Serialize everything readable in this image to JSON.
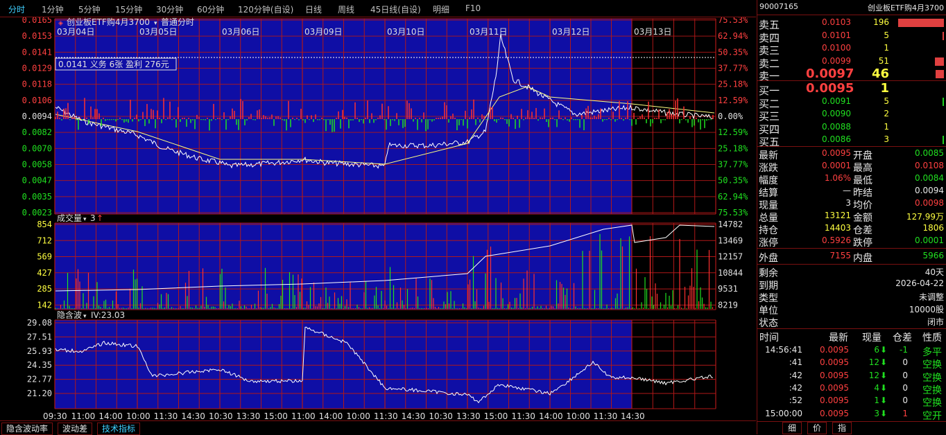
{
  "toolbar": {
    "items": [
      "分时",
      "1分钟",
      "5分钟",
      "15分钟",
      "30分钟",
      "60分钟",
      "120分钟(自设)",
      "日线",
      "周线",
      "45日线(自设)",
      "明细",
      "F10"
    ],
    "active_index": 0
  },
  "chart": {
    "instrument_label": "创业板ETF购4月3700",
    "mode_label": "普通分时",
    "days": [
      "03月04日",
      "03月05日",
      "03月06日",
      "03月09日",
      "03月10日",
      "03月11日",
      "03月12日",
      "03月13日"
    ],
    "price_axis": [
      "0.0165",
      "0.0153",
      "0.0141",
      "0.0129",
      "0.0118",
      "0.0106",
      "0.0094",
      "0.0082",
      "0.0070",
      "0.0058",
      "0.0047",
      "0.0035",
      "0.0023"
    ],
    "pct_axis": [
      "75.53%",
      "62.94%",
      "50.35%",
      "37.77%",
      "25.18%",
      "12.59%",
      "0.00%",
      "12.59%",
      "25.18%",
      "37.77%",
      "50.35%",
      "62.94%",
      "75.53%"
    ],
    "tooltip": "0.0141 义务  6张  盈利  276元",
    "volume_label": "成交量",
    "volume_value": "3",
    "volume_axis_left": [
      "854",
      "712",
      "569",
      "427",
      "285",
      "142"
    ],
    "volume_axis_right": [
      "14782",
      "13469",
      "12157",
      "10844",
      "9531",
      "8219"
    ],
    "iv_label": "隐含波",
    "iv_value": "IV:23.03",
    "iv_axis": [
      "29.08",
      "27.51",
      "25.93",
      "24.35",
      "22.77",
      "21.20"
    ],
    "time_axis": [
      "09:30",
      "11:00",
      "14:00",
      "10:00",
      "11:30",
      "14:30",
      "10:30",
      "13:30",
      "15:00",
      "11:00",
      "14:00",
      "10:00",
      "11:30",
      "14:30",
      "10:30",
      "13:30",
      "15:00",
      "11:30",
      "14:00",
      "10:00",
      "11:30",
      "14:30"
    ]
  },
  "bottom_tabs": [
    "隐含波动率",
    "波动差",
    "技术指标"
  ],
  "bottom_active": 2,
  "quote": {
    "code": "90007165",
    "name": "创业板ETF购4月3700",
    "asks": [
      {
        "label": "卖五",
        "price": "0.0103",
        "vol": "196",
        "bar": 1.0
      },
      {
        "label": "卖四",
        "price": "0.0101",
        "vol": "5",
        "bar": 0.02
      },
      {
        "label": "卖三",
        "price": "0.0100",
        "vol": "1",
        "bar": 0.0
      },
      {
        "label": "卖二",
        "price": "0.0099",
        "vol": "51",
        "bar": 0.2
      },
      {
        "label": "卖一",
        "price": "0.0097",
        "vol": "46",
        "bar": 0.18
      }
    ],
    "bids": [
      {
        "label": "买一",
        "price": "0.0095",
        "vol": "1",
        "bar": 0.0
      },
      {
        "label": "买二",
        "price": "0.0091",
        "vol": "5",
        "bar": 0.02
      },
      {
        "label": "买三",
        "price": "0.0090",
        "vol": "2",
        "bar": 0.0
      },
      {
        "label": "买四",
        "price": "0.0088",
        "vol": "1",
        "bar": 0.0
      },
      {
        "label": "买五",
        "price": "0.0086",
        "vol": "3",
        "bar": 0.01
      }
    ],
    "stats": [
      {
        "l1": "最新",
        "v1": "0.0095",
        "c1": "red",
        "l2": "开盘",
        "v2": "0.0085",
        "c2": "green"
      },
      {
        "l1": "涨跌",
        "v1": "0.0001",
        "c1": "red",
        "l2": "最高",
        "v2": "0.0108",
        "c2": "red"
      },
      {
        "l1": "幅度",
        "v1": "1.06%",
        "c1": "red",
        "l2": "最低",
        "v2": "0.0084",
        "c2": "green"
      },
      {
        "l1": "结算",
        "v1": "—",
        "c1": "white",
        "l2": "昨结",
        "v2": "0.0094",
        "c2": "white"
      },
      {
        "l1": "现量",
        "v1": "3",
        "c1": "white",
        "l2": "均价",
        "v2": "0.0098",
        "c2": "red"
      },
      {
        "l1": "总量",
        "v1": "13121",
        "c1": "yellow",
        "l2": "金额",
        "v2": "127.99万",
        "c2": "yellow"
      },
      {
        "l1": "持仓",
        "v1": "14403",
        "c1": "yellow",
        "l2": "仓差",
        "v2": "1806",
        "c2": "yellow"
      },
      {
        "l1": "涨停",
        "v1": "0.5926",
        "c1": "red",
        "l2": "跌停",
        "v2": "0.0001",
        "c2": "green"
      }
    ],
    "outer": {
      "label": "外盘",
      "value": "7155",
      "inner_label": "内盘",
      "inner_value": "5966"
    },
    "info": [
      {
        "label": "剩余",
        "value": "40天"
      },
      {
        "label": "到期",
        "value": "2026-04-22"
      },
      {
        "label": "类型",
        "value": "未调整"
      },
      {
        "label": "单位",
        "value": "10000股"
      },
      {
        "label": "状态",
        "value": "闭市"
      }
    ],
    "ticks_header": {
      "time": "时间",
      "last": "最新",
      "qty": "现量",
      "oi": "仓差",
      "nature": "性质"
    },
    "ticks": [
      {
        "time": "14:56:41",
        "price": "0.0095",
        "qty": "6",
        "oi": "-1",
        "nature": "多平"
      },
      {
        "time": ":41",
        "price": "0.0095",
        "qty": "12",
        "oi": "0",
        "nature": "空换"
      },
      {
        "time": ":42",
        "price": "0.0095",
        "qty": "12",
        "oi": "0",
        "nature": "空换"
      },
      {
        "time": ":42",
        "price": "0.0095",
        "qty": "4",
        "oi": "0",
        "nature": "空换"
      },
      {
        "time": ":52",
        "price": "0.0095",
        "qty": "1",
        "oi": "0",
        "nature": "空换"
      },
      {
        "time": "15:00:00",
        "price": "0.0095",
        "qty": "3",
        "oi": "1",
        "nature": "空开"
      }
    ],
    "right_tabs": [
      "细",
      "价",
      "指"
    ]
  }
}
